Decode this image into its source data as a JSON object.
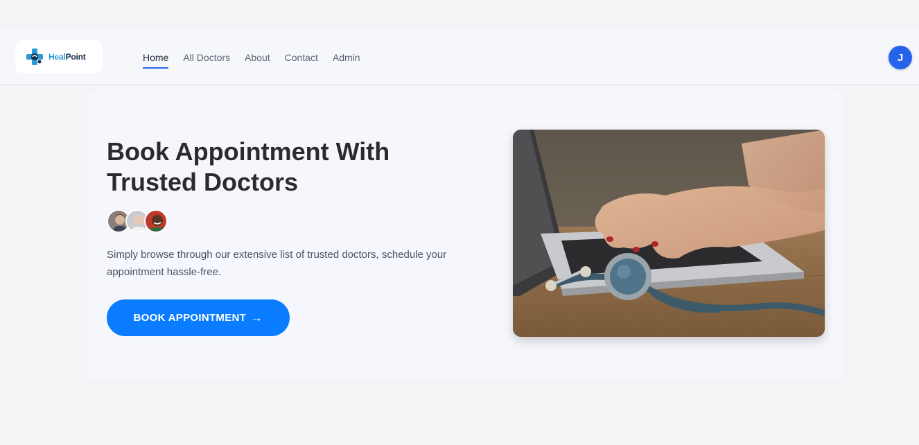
{
  "brand": {
    "name_part1": "Heal",
    "name_part2": "Point"
  },
  "nav": {
    "items": [
      {
        "label": "Home",
        "active": true
      },
      {
        "label": "All Doctors",
        "active": false
      },
      {
        "label": "About",
        "active": false
      },
      {
        "label": "Contact",
        "active": false
      },
      {
        "label": "Admin",
        "active": false
      }
    ]
  },
  "user": {
    "initial": "J"
  },
  "hero": {
    "title_line1": "Book Appointment With",
    "title_line2": "Trusted Doctors",
    "description": "Simply browse through our extensive list of trusted doctors, schedule your appointment hassle-free.",
    "cta_label": "BOOK APPOINTMENT",
    "cta_arrow": "→"
  },
  "colors": {
    "accent": "#0a7cff",
    "avatar_bg": "#2563eb",
    "page_bg": "#f3f4f6"
  }
}
